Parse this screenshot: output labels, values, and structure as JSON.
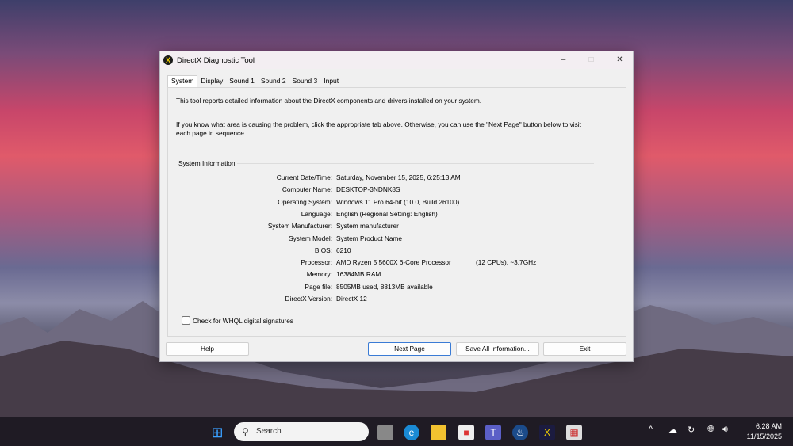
{
  "window": {
    "title": "DirectX Diagnostic Tool",
    "minimize": "–",
    "maximize": "□",
    "close": "✕"
  },
  "tabs": [
    "System",
    "Display",
    "Sound 1",
    "Sound 2",
    "Sound 3",
    "Input"
  ],
  "intro1": "This tool reports detailed information about the DirectX components and drivers installed on your system.",
  "intro2a": "If you know what area is causing the problem, click the appropriate tab above.  Otherwise, you can use the \"Next Page\" button below to visit",
  "intro2b": "each page in sequence.",
  "group_label": "System Information",
  "rows": [
    {
      "label": "Current Date/Time:",
      "value": "Saturday, November 15, 2025, 6:25:13 AM"
    },
    {
      "label": "Computer Name:",
      "value": "DESKTOP-3NDNK8S"
    },
    {
      "label": "Operating System:",
      "value": "Windows 11 Pro 64-bit (10.0, Build 26100)"
    },
    {
      "label": "Language:",
      "value": "English (Regional Setting: English)"
    },
    {
      "label": "System Manufacturer:",
      "value": "System manufacturer"
    },
    {
      "label": "System Model:",
      "value": "System Product Name"
    },
    {
      "label": "BIOS:",
      "value": "6210"
    },
    {
      "label": "Processor:",
      "value": "AMD Ryzen 5 5600X 6-Core Processor",
      "extra": "(12 CPUs), ~3.7GHz"
    },
    {
      "label": "Memory:",
      "value": "16384MB RAM"
    },
    {
      "label": "Page file:",
      "value": "8505MB used, 8813MB available"
    },
    {
      "label": "DirectX Version:",
      "value": "DirectX 12"
    }
  ],
  "whql_label": "Check for WHQL digital signatures",
  "buttons": {
    "help": "Help",
    "next": "Next Page",
    "save": "Save All Information...",
    "exit": "Exit"
  },
  "taskbar": {
    "search_placeholder": "Search",
    "time": "6:28 AM",
    "date": "11/15/2025"
  }
}
